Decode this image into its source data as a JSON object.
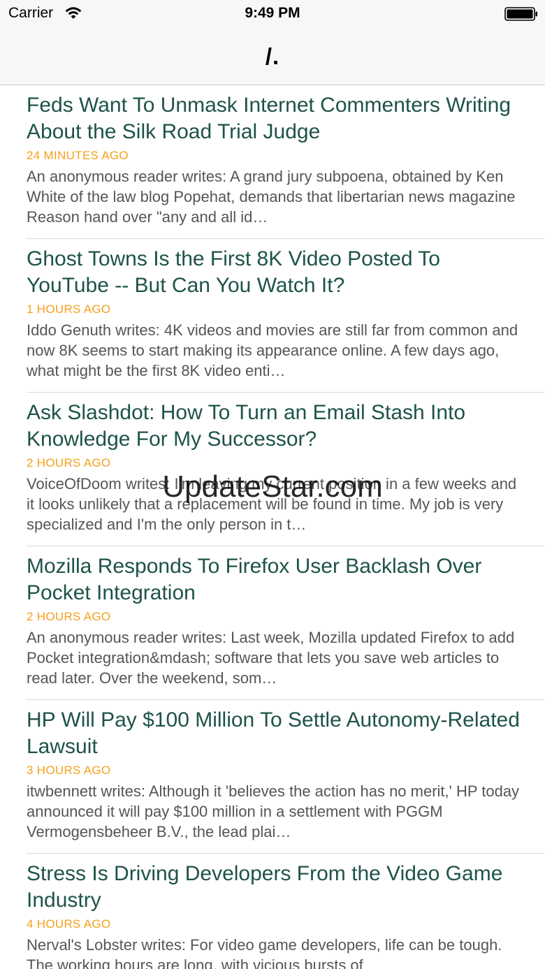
{
  "status_bar": {
    "carrier": "Carrier",
    "time": "9:49 PM",
    "wifi_icon": "wifi-icon",
    "battery_icon": "battery-icon"
  },
  "nav": {
    "title": "/."
  },
  "colors": {
    "title": "#1e5349",
    "timestamp": "#f5a01c",
    "summary": "#555555"
  },
  "articles": [
    {
      "title": "Feds Want To Unmask Internet Commenters Writing About the Silk Road Trial Judge",
      "time": "24 MINUTES AGO",
      "summary": "An anonymous reader writes: A grand jury subpoena, obtained by Ken White of the law blog Popehat, demands that libertarian news magazine Reason hand over \"any and all id…"
    },
    {
      "title": "Ghost Towns Is the First 8K Video Posted To YouTube -- But Can You Watch It?",
      "time": "1 HOURS AGO",
      "summary": "Iddo Genuth writes: 4K videos and movies are still far from common and now 8K seems to start making its appearance online. A few days ago, what might be the first 8K video enti…"
    },
    {
      "title": "Ask Slashdot: How To Turn an Email Stash Into Knowledge For My Successor?",
      "time": "2 HOURS AGO",
      "summary": "VoiceOfDoom writes: I'm leaving my current position in a few weeks and it looks unlikely that a replacement will be found in time. My job is very specialized and I'm the only person in t…"
    },
    {
      "title": "Mozilla Responds To Firefox User Backlash Over Pocket Integration",
      "time": "2 HOURS AGO",
      "summary": "An anonymous reader writes: Last week, Mozilla updated Firefox to add Pocket integration&mdash; software that lets you save web articles to read later. Over the weekend, som…"
    },
    {
      "title": "HP Will Pay $100 Million To Settle Autonomy-Related Lawsuit",
      "time": "3 HOURS AGO",
      "summary": "itwbennett writes: Although it 'believes the action has no merit,' HP today announced it will pay $100 million in a settlement with PGGM Vermogensbeheer B.V., the lead plai…"
    },
    {
      "title": "Stress Is Driving Developers From the Video Game Industry",
      "time": "4 HOURS AGO",
      "summary": "Nerval's Lobster writes: For video game developers, life can be tough. The working hours are long, with vicious bursts of"
    }
  ],
  "watermark": "UpdateStar.com"
}
